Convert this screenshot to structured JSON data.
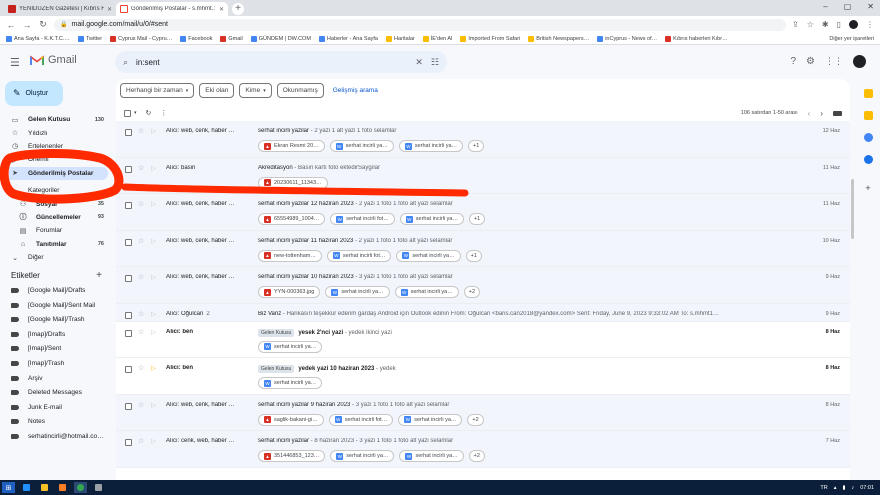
{
  "browser": {
    "tabs": [
      {
        "favicon": "yd",
        "title": "YENİDÜZEN Gazetesi | Kıbrıs Hab"
      },
      {
        "favicon": "gmail",
        "title": "Gönderilmiş Postalar - s.mhmt.: "
      }
    ],
    "new_tab": "+",
    "url": "mail.google.com/mail/u/0/#sent",
    "bookmarks": [
      "Ana Sayfa - K.K.T.C.…",
      "Twitter",
      "Cyprus Mail - Cypru…",
      "Facebook",
      "Gmail",
      "GÜNDEM | DW.COM",
      "Haberler - Ana Sayfa",
      "Haritalar",
      "İE'den Al",
      "Imported From Safari",
      "British Newspapers…",
      "inCyprus - News of…",
      "Kıbrıs haberleri Kıbr…"
    ],
    "other_bookmarks": "Diğer yer işaretleri"
  },
  "gmail": {
    "logo_text": "Gmail",
    "search": {
      "value": "in:sent"
    },
    "compose_label": "Oluştur",
    "nav": [
      {
        "label": "Gelen Kutusu",
        "count": "130",
        "icon": "inbox-icon",
        "bold": true
      },
      {
        "label": "Yıldızlı",
        "count": "",
        "icon": "star-icon"
      },
      {
        "label": "Ertelenenler",
        "count": "",
        "icon": "clock-icon"
      },
      {
        "label": "Önemli",
        "count": "",
        "icon": "important-icon"
      },
      {
        "label": "Gönderilmiş Postalar",
        "count": "",
        "icon": "send-icon",
        "active": true
      }
    ],
    "categories_label": "Kategoriler",
    "categories": [
      {
        "label": "Sosyal",
        "count": "35",
        "icon": "people-icon",
        "bold": true
      },
      {
        "label": "Güncellemeler",
        "count": "93",
        "icon": "info-icon",
        "bold": true
      },
      {
        "label": "Forumlar",
        "count": "",
        "icon": "forum-icon"
      },
      {
        "label": "Tanıtımlar",
        "count": "76",
        "icon": "tag-icon",
        "bold": true
      }
    ],
    "more_label": "Diğer",
    "labels_title": "Etiketler",
    "labels": [
      "[Google Mail]/Drafts",
      "[Google Mail]/Sent Mail",
      "[Google Mail]/Trash",
      "[Imap]/Drafts",
      "[Imap]/Sent",
      "[Imap]/Trash",
      "Arşiv",
      "Deleted Messages",
      "Junk E-mail",
      "Notes",
      "serhatincirli@hotmail.co…"
    ],
    "filters": [
      {
        "label": "Herhangi bir zaman",
        "dropdown": true
      },
      {
        "label": "Eki olan",
        "dropdown": false
      },
      {
        "label": "Kime",
        "dropdown": true
      },
      {
        "label": "Okunmamış",
        "dropdown": false
      }
    ],
    "advanced_search": "Gelişmiş arama",
    "pager_text": "106 satırdan 1-50 arası",
    "emails": [
      {
        "from": "Alıcı: web, cenk, haber …",
        "thread": "",
        "badge": "",
        "subject": "serhat incirli yazilar",
        "snippet": " - 2 yazi 1 alt yazi 1 foto selamlar",
        "date": "12 Haz",
        "unread": false,
        "important": false,
        "attachments": [
          {
            "type": "img",
            "name": "Ekran Resmi 20…"
          },
          {
            "type": "doc",
            "name": "serhat incirli ya…"
          },
          {
            "type": "doc",
            "name": "serhat incirli ya…"
          }
        ],
        "more": "+1"
      },
      {
        "from": "Alıcı: basin",
        "thread": "",
        "badge": "",
        "subject": "Akreditasyon",
        "snippet": " - Basın kartı foto ektedirSaygılar",
        "date": "11 Haz",
        "unread": false,
        "important": false,
        "attachments": [
          {
            "type": "img",
            "name": "20230611_11343…"
          }
        ],
        "more": ""
      },
      {
        "from": "Alıcı: web, cenk, haber …",
        "thread": "",
        "badge": "",
        "subject": "serhat incirli yazilar 12 haziran 2023",
        "snippet": " - 2 yazi 1 foto 1 foto alt yazi selamlar",
        "date": "11 Haz",
        "unread": false,
        "important": false,
        "attachments": [
          {
            "type": "img",
            "name": "65554989_1004…"
          },
          {
            "type": "doc",
            "name": "serhat incirli fot…"
          },
          {
            "type": "doc",
            "name": "serhat incirli ya…"
          }
        ],
        "more": "+1"
      },
      {
        "from": "Alıcı: web, cenk, haber …",
        "thread": "",
        "badge": "",
        "subject": "serhat incirli yazilar 11 haziran 2023",
        "snippet": " - 2 yazi 1 foto 1 foto alt yazi selamlar",
        "date": "10 Haz",
        "unread": false,
        "important": false,
        "attachments": [
          {
            "type": "img",
            "name": "new-tottenham…"
          },
          {
            "type": "doc",
            "name": "serhat incirli fot…"
          },
          {
            "type": "doc",
            "name": "serhat incirli ya…"
          }
        ],
        "more": "+1"
      },
      {
        "from": "Alıcı: web, cenk, haber …",
        "thread": "",
        "badge": "",
        "subject": "serhat incirli yazilar 10 haziran 2023",
        "snippet": " - 3 yazi 1 foto 1 foto alt yazi selamlar",
        "date": "9 Haz",
        "unread": false,
        "important": false,
        "attachments": [
          {
            "type": "img",
            "name": "YYN-000363.jpg"
          },
          {
            "type": "doc",
            "name": "serhat incirli ya…"
          },
          {
            "type": "doc",
            "name": "serhat incirli ya…"
          }
        ],
        "more": "+2"
      },
      {
        "from": "Alıcı: Oğulcan",
        "thread": "2",
        "badge": "",
        "subject": "Biz Vanz",
        "snippet": " - Harikasın teşekkür ederim gardaş Android için Outlook edinin From: Oğulcan <baris.can2018@yandex.com> Sent: Friday, June 9, 2023 9:33:02 AM To: s.mhmt1…",
        "date": "9 Haz",
        "unread": false,
        "important": false,
        "attachments": [],
        "more": ""
      },
      {
        "from": "Alıcı: ben",
        "thread": "",
        "badge": "Gelen Kutusu",
        "subject": "yesek 2'nci yazi",
        "snippet": " - yedek ikinci yazi",
        "date": "8 Haz",
        "unread": true,
        "important": false,
        "attachments": [
          {
            "type": "doc",
            "name": "serhat incirli ya…"
          }
        ],
        "more": ""
      },
      {
        "from": "Alıcı: ben",
        "thread": "",
        "badge": "Gelen Kutusu",
        "subject": "yedek yazi 10 haziran 2023",
        "snippet": " - yedek",
        "date": "8 Haz",
        "unread": true,
        "important": true,
        "attachments": [
          {
            "type": "doc",
            "name": "serhat incirli ya…"
          }
        ],
        "more": ""
      },
      {
        "from": "Alıcı: web, cenk, haber …",
        "thread": "",
        "badge": "",
        "subject": "serhat incirli yazilar 9 haziran 2023",
        "snippet": " - 3 yazi 1 foto 1 foto alt yazi selamlar",
        "date": "8 Haz",
        "unread": false,
        "important": false,
        "attachments": [
          {
            "type": "img",
            "name": "saglik-bakani-gi…"
          },
          {
            "type": "doc",
            "name": "serhat incirli fot…"
          },
          {
            "type": "doc",
            "name": "serhat incirli ya…"
          }
        ],
        "more": "+2"
      },
      {
        "from": "Alıcı: cenk, web, haber …",
        "thread": "",
        "badge": "",
        "subject": "serhat incirli yazilar",
        "snippet": " - 8 haziran 2023 - 3 yazi 1 foto 1 foto alt yazi selamlar",
        "date": "7 Haz",
        "unread": false,
        "important": false,
        "attachments": [
          {
            "type": "img",
            "name": "351446853_123…"
          },
          {
            "type": "doc",
            "name": "serhat incirli ya…"
          },
          {
            "type": "doc",
            "name": "serhat incirli ya…"
          }
        ],
        "more": "+2"
      }
    ]
  },
  "taskbar": {
    "lang": "TR",
    "time": "07:01"
  },
  "colors": {
    "gmail_red": "#ea4335",
    "compose_bg": "#c2e7ff",
    "active_nav_bg": "#d3e3fd",
    "annotation_red": "#ff2a00"
  }
}
